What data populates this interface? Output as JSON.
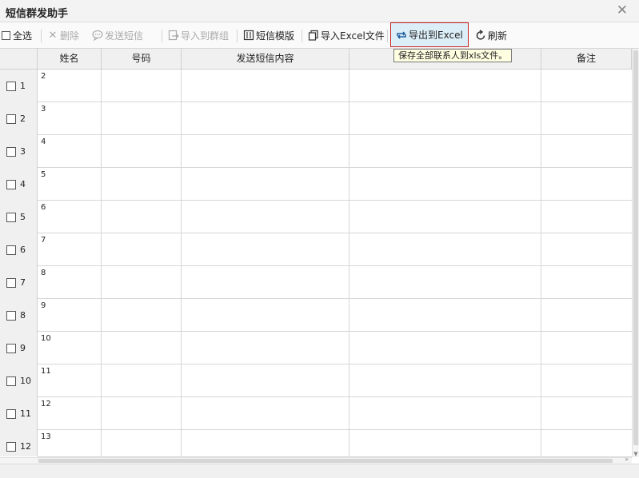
{
  "window": {
    "title": "短信群发助手"
  },
  "toolbar": {
    "select_all": "全选",
    "delete": "删除",
    "send_sms": "发送短信",
    "import_to_group": "导入到群组",
    "sms_template": "短信模版",
    "import_excel": "导入Excel文件",
    "export_excel": "导出到Excel",
    "refresh": "刷新"
  },
  "tooltip": {
    "export_excel": "保存全部联系人到xls文件。"
  },
  "columns": [
    "姓名",
    "号码",
    "发送短信内容",
    "",
    "备注"
  ],
  "rows": [
    {
      "num": "1",
      "name": "2"
    },
    {
      "num": "2",
      "name": "3"
    },
    {
      "num": "3",
      "name": "4"
    },
    {
      "num": "4",
      "name": "5"
    },
    {
      "num": "5",
      "name": "6"
    },
    {
      "num": "6",
      "name": "7"
    },
    {
      "num": "7",
      "name": "8"
    },
    {
      "num": "8",
      "name": "9"
    },
    {
      "num": "9",
      "name": "10"
    },
    {
      "num": "10",
      "name": "11"
    },
    {
      "num": "11",
      "name": "12"
    },
    {
      "num": "12",
      "name": "13"
    }
  ],
  "colors": {
    "highlight_border": "#c81e1e",
    "highlight_bg": "#dceef8",
    "tooltip_bg": "#ffffe1"
  },
  "icons": {
    "close": "close-icon",
    "delete": "x-icon",
    "send_sms": "chat-bubble-icon",
    "import_to_group": "import-icon",
    "sms_template": "template-icon",
    "import_excel": "copy-icon",
    "export_excel": "export-arrows-icon",
    "refresh": "refresh-icon"
  }
}
